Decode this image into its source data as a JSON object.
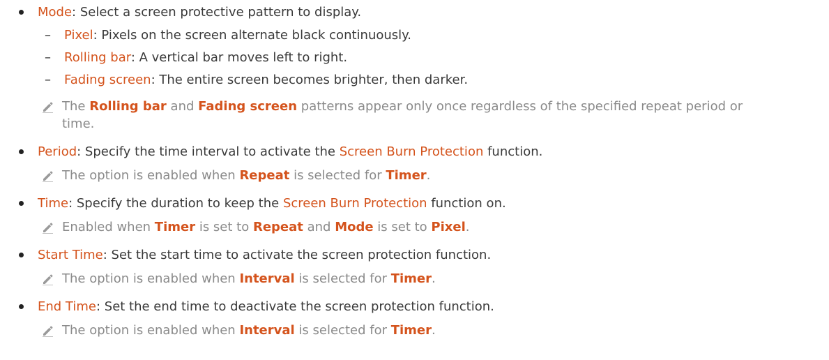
{
  "items": [
    {
      "term": "Mode",
      "desc": ": Select a screen protective pattern to display.",
      "subitems": [
        {
          "dash": "–",
          "term": "Pixel",
          "desc": ": Pixels on the screen alternate black continuously."
        },
        {
          "dash": "–",
          "term": "Rolling bar",
          "desc": ": A vertical bar moves left to right."
        },
        {
          "dash": "–",
          "term": "Fading screen",
          "desc": ": The entire screen becomes brighter, then darker."
        }
      ],
      "note": {
        "parts": [
          "The ",
          "Rolling bar",
          " and ",
          "Fading screen",
          " patterns appear only once regardless of the specified repeat period or"
        ],
        "cont": "time."
      }
    },
    {
      "term": "Period",
      "desc_a": ": Specify the time interval to activate the ",
      "term2": "Screen Burn Protection",
      "desc_b": " function.",
      "note": {
        "parts": [
          "The option is enabled when ",
          "Repeat",
          " is selected for ",
          "Timer",
          "."
        ]
      }
    },
    {
      "term": "Time",
      "desc_a": ": Specify the duration to keep the ",
      "term2": "Screen Burn Protection",
      "desc_b": " function on.",
      "note": {
        "parts": [
          "Enabled when ",
          "Timer",
          " is set to ",
          "Repeat",
          " and ",
          "Mode",
          " is set to ",
          "Pixel",
          "."
        ]
      }
    },
    {
      "term": "Start Time",
      "desc": ": Set the start time to activate the screen protection function.",
      "note": {
        "parts": [
          "The option is enabled when ",
          "Interval",
          " is selected for ",
          "Timer",
          "."
        ]
      }
    },
    {
      "term": "End Time",
      "desc": ": Set the end time to deactivate the screen protection function.",
      "note": {
        "parts": [
          "The option is enabled when ",
          "Interval",
          " is selected for ",
          "Timer",
          "."
        ]
      }
    }
  ],
  "icons": {
    "note": "pencil-icon"
  },
  "colors": {
    "term": "#d4531c",
    "text": "#3a3a3a",
    "note": "#8a8a8a"
  }
}
